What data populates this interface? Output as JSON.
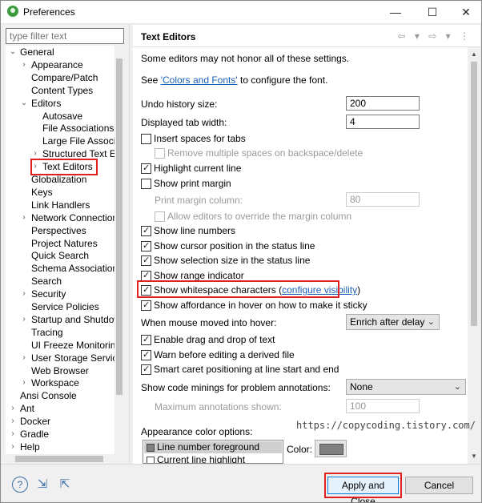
{
  "window": {
    "title": "Preferences",
    "controls": {
      "minimize": "—",
      "maximize": "☐",
      "close": "✕"
    }
  },
  "filter": {
    "placeholder": "type filter text"
  },
  "tree": [
    {
      "label": "General",
      "arrow": "⌄",
      "indent": 0
    },
    {
      "label": "Appearance",
      "arrow": "›",
      "indent": 1
    },
    {
      "label": "Compare/Patch",
      "arrow": "",
      "indent": 1
    },
    {
      "label": "Content Types",
      "arrow": "",
      "indent": 1
    },
    {
      "label": "Editors",
      "arrow": "⌄",
      "indent": 1
    },
    {
      "label": "Autosave",
      "arrow": "",
      "indent": 2
    },
    {
      "label": "File Associations",
      "arrow": "",
      "indent": 2
    },
    {
      "label": "Large File Associa",
      "arrow": "",
      "indent": 2
    },
    {
      "label": "Structured Text Ec",
      "arrow": "›",
      "indent": 2
    },
    {
      "label": "Text Editors",
      "arrow": "›",
      "indent": 2,
      "selected": true
    },
    {
      "label": "Globalization",
      "arrow": "",
      "indent": 1
    },
    {
      "label": "Keys",
      "arrow": "",
      "indent": 1
    },
    {
      "label": "Link Handlers",
      "arrow": "",
      "indent": 1
    },
    {
      "label": "Network Connection",
      "arrow": "›",
      "indent": 1
    },
    {
      "label": "Perspectives",
      "arrow": "",
      "indent": 1
    },
    {
      "label": "Project Natures",
      "arrow": "",
      "indent": 1
    },
    {
      "label": "Quick Search",
      "arrow": "",
      "indent": 1
    },
    {
      "label": "Schema Associations",
      "arrow": "",
      "indent": 1
    },
    {
      "label": "Search",
      "arrow": "",
      "indent": 1
    },
    {
      "label": "Security",
      "arrow": "›",
      "indent": 1
    },
    {
      "label": "Service Policies",
      "arrow": "",
      "indent": 1
    },
    {
      "label": "Startup and Shutdow",
      "arrow": "›",
      "indent": 1
    },
    {
      "label": "Tracing",
      "arrow": "",
      "indent": 1
    },
    {
      "label": "UI Freeze Monitoring",
      "arrow": "",
      "indent": 1
    },
    {
      "label": "User Storage Service",
      "arrow": "›",
      "indent": 1
    },
    {
      "label": "Web Browser",
      "arrow": "",
      "indent": 1
    },
    {
      "label": "Workspace",
      "arrow": "›",
      "indent": 1
    },
    {
      "label": "Ansi Console",
      "arrow": "",
      "indent": 0
    },
    {
      "label": "Ant",
      "arrow": "›",
      "indent": 0
    },
    {
      "label": "Docker",
      "arrow": "›",
      "indent": 0
    },
    {
      "label": "Gradle",
      "arrow": "›",
      "indent": 0
    },
    {
      "label": "Help",
      "arrow": "›",
      "indent": 0
    }
  ],
  "page": {
    "title": "Text Editors",
    "nav_icons": "⇦ ▾ ⇨ ▾ ⋮",
    "intro": "Some editors may not honor all of these settings.",
    "see": "See ",
    "colors_link": "'Colors and Fonts'",
    "see_suffix": " to configure the font.",
    "undo_label": "Undo history size:",
    "undo_value": "200",
    "tab_label": "Displayed tab width:",
    "tab_value": "4",
    "insert_spaces": "Insert spaces for tabs",
    "remove_spaces": "Remove multiple spaces on backspace/delete",
    "highlight_line": "Highlight current line",
    "show_print_margin": "Show print margin",
    "print_margin_column": "Print margin column:",
    "print_margin_value": "80",
    "allow_override": "Allow editors to override the margin column",
    "show_line_numbers": "Show line numbers",
    "show_cursor_pos": "Show cursor position in the status line",
    "show_selection_size": "Show selection size in the status line",
    "show_range": "Show range indicator",
    "show_whitespace": "Show whitespace characters",
    "configure_visibility": "configure visibility",
    "paren_open": "(",
    "paren_close": ")",
    "show_affordance": "Show affordance in hover on how to make it sticky",
    "hover_label": "When mouse moved into hover:",
    "hover_value": "Enrich after delay",
    "drag_drop": "Enable drag and drop of text",
    "warn_derived": "Warn before editing a derived file",
    "smart_caret": "Smart caret positioning at line start and end",
    "code_minings_label": "Show code minings for problem annotations:",
    "code_minings_value": "None",
    "max_annotations_label": "Maximum annotations shown:",
    "max_annotations_value": "100",
    "appearance_label": "Appearance color options:",
    "color_options": [
      "Line number foreground",
      "Current line highlight"
    ],
    "color_label": "Color:",
    "watermark": "https://copycoding.tistory.com/"
  },
  "buttons": {
    "apply_close": "Apply and Close",
    "cancel": "Cancel"
  },
  "bottom_icons": {
    "help": "?",
    "import": "⇲",
    "export": "⇱"
  }
}
